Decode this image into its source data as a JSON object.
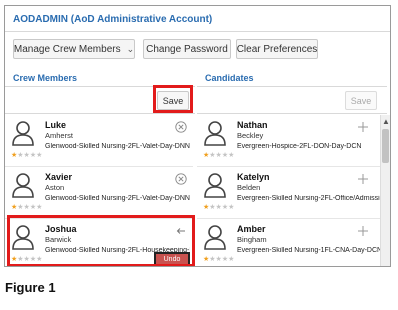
{
  "header": {
    "title": "AODADMIN (AoD Administrative Account)"
  },
  "toolbar": {
    "manage_label": "Manage Crew Members",
    "change_password_label": "Change Password",
    "clear_prefs_label": "Clear Preferences"
  },
  "crew": {
    "heading": "Crew Members",
    "save_label": "Save",
    "members": [
      {
        "first": "Luke",
        "last": "Amherst",
        "assignment": "Glenwood-Skilled Nursing-2FL-Valet-Day-DNN",
        "rating": 1,
        "action_icon": "remove-circle-icon"
      },
      {
        "first": "Xavier",
        "last": "Aston",
        "assignment": "Glenwood-Skilled Nursing-2FL-Valet-Day-DNN",
        "rating": 1,
        "action_icon": "remove-circle-icon"
      },
      {
        "first": "Joshua",
        "last": "Barwick",
        "assignment": "Glenwood-Skilled Nursing-2FL-Housekeeping-Day",
        "rating": 1,
        "action_icon": "undo-icon",
        "badge": "Undo"
      }
    ]
  },
  "candidates": {
    "heading": "Candidates",
    "save_label": "Save",
    "members": [
      {
        "first": "Nathan",
        "last": "Beckley",
        "assignment": "Evergreen-Hospice-2FL-DON-Day-DCN",
        "rating": 1,
        "action_icon": "add-plus-icon"
      },
      {
        "first": "Katelyn",
        "last": "Belden",
        "assignment": "Evergreen-Skilled Nursing-2FL-Office/Admissions-Day",
        "rating": 1,
        "action_icon": "add-plus-icon"
      },
      {
        "first": "Amber",
        "last": "Bingham",
        "assignment": "Evergreen-Skilled Nursing-1FL-CNA-Day-DCN",
        "rating": 1,
        "action_icon": "add-plus-icon"
      }
    ]
  },
  "caption": "Figure 1",
  "colors": {
    "accent": "#2a6cb0",
    "highlight": "#e21b1b",
    "star": "#f0a020",
    "undo_badge": "#c9524f"
  }
}
